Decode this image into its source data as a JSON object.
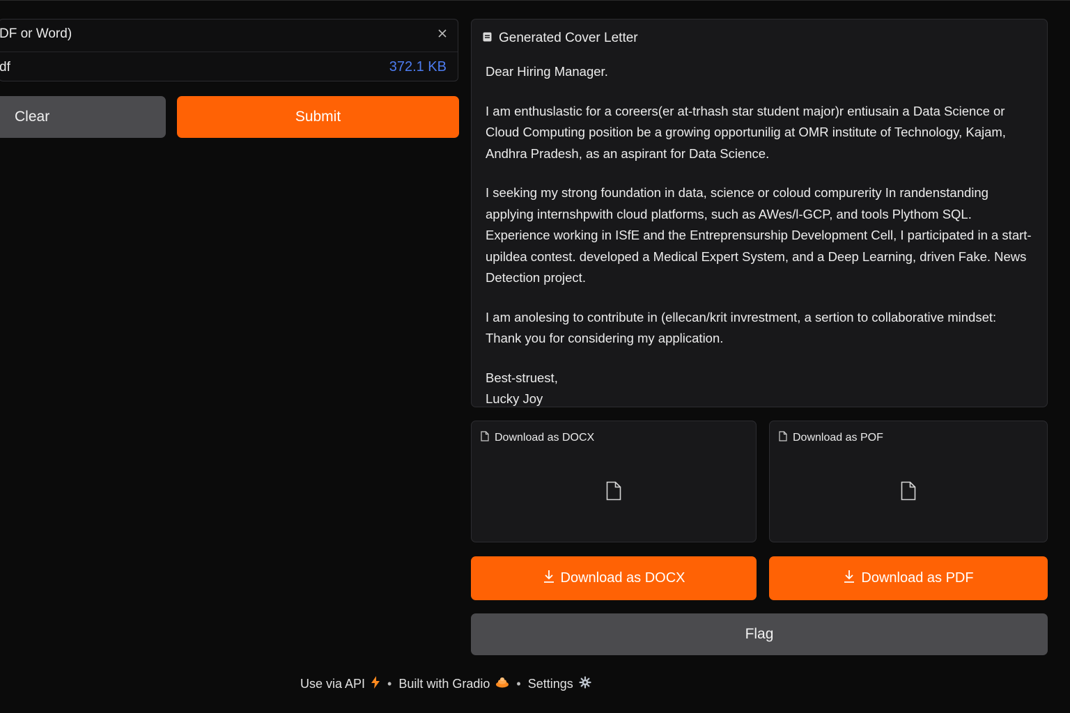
{
  "upload": {
    "label": "DF or Word)",
    "file_name": "df",
    "file_size": "372.1 KB"
  },
  "actions": {
    "clear_label": "Clear",
    "submit_label": "Submit"
  },
  "letter": {
    "title": "Generated Cover Letter",
    "greeting": "Dear Hiring Manager.",
    "p1": "I am enthuslastic for a coreers(er at-trhash star student major)r entiusain a Data Science or Cloud Computing position be a growing opportunilig at OMR institute of Technology, Kajam, Andhra Pradesh, as an aspirant for Data Science.",
    "p2": "I seeking my strong foundation in data, science or coloud compurerity  In randenstanding applying internshpwith cloud platforms, such as AWes/l-GCP, and tools Plythom SQL. Experience working in ISfE and the Entreprensurship Development Cell, I participated in a start-upildea contest. developed a Medical Expert System, and a Deep Learning, driven Fake. News Detection project.",
    "p3_line1": "I am anolesing to contribute in (ellecan/krit invrestment, a sertion to collaborative mindset:",
    "p3_line2": "Thank you for considering my application.",
    "closing": "Best-struest,",
    "signature": "Lucky Joy"
  },
  "files": {
    "docx_label": "Download as DOCX",
    "pdf_label": "Download as POF"
  },
  "downloads": {
    "docx_button": "Download as DOCX",
    "pdf_button": "Download as PDF"
  },
  "flag_label": "Flag",
  "footer": {
    "api": "Use via API",
    "built": "Built with Gradio",
    "settings": "Settings",
    "separator": "•"
  },
  "colors": {
    "accent": "#ff6205",
    "size_link": "#4d7cf0",
    "background": "#0b0b0b",
    "panel": "#18181a"
  },
  "icons": [
    "close-icon",
    "document-icon",
    "file-icon",
    "download-icon",
    "lightning-icon",
    "gradio-logo-icon",
    "gear-icon"
  ]
}
